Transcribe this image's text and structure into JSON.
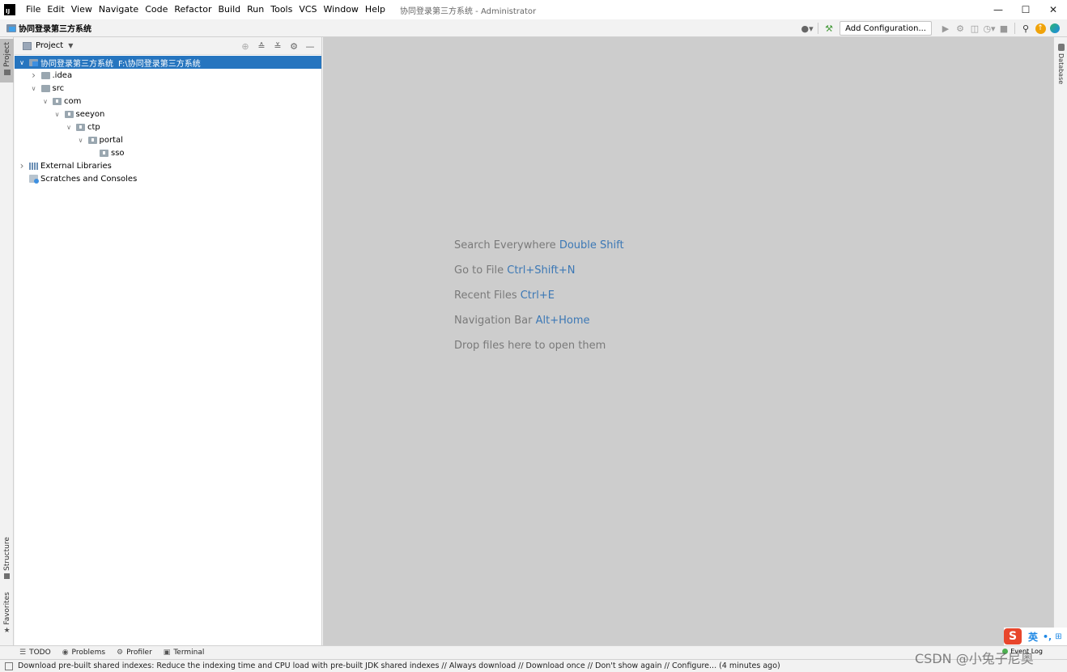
{
  "titlebar": {
    "logo": "IJ",
    "menu": [
      "File",
      "Edit",
      "View",
      "Navigate",
      "Code",
      "Refactor",
      "Build",
      "Run",
      "Tools",
      "VCS",
      "Window",
      "Help"
    ],
    "window_title": "协同登录第三方系统 - Administrator",
    "buttons": {
      "minimize": "—",
      "maximize": "☐",
      "close": "✕"
    }
  },
  "navbar": {
    "project_name": "协同登录第三方系统",
    "add_configuration": "Add Configuration...",
    "icons": [
      "user-icon",
      "hammer-icon",
      "run-icon",
      "debug-icon",
      "coverage-icon",
      "profile-icon",
      "stop-icon",
      "search-icon",
      "update-icon",
      "jetbrains-icon"
    ]
  },
  "left_stripe": {
    "project": "Project",
    "structure": "Structure",
    "favorites": "Favorites"
  },
  "project_panel": {
    "title": "Project",
    "tree": [
      {
        "label": "协同登录第三方系统",
        "path": "F:\\协同登录第三方系统",
        "depth": 0,
        "expanded": true,
        "type": "project",
        "selected": true
      },
      {
        "label": ".idea",
        "depth": 1,
        "expanded": false,
        "type": "folder"
      },
      {
        "label": "src",
        "depth": 1,
        "expanded": true,
        "type": "folder"
      },
      {
        "label": "com",
        "depth": 2,
        "expanded": true,
        "type": "package"
      },
      {
        "label": "seeyon",
        "depth": 3,
        "expanded": true,
        "type": "package"
      },
      {
        "label": "ctp",
        "depth": 4,
        "expanded": true,
        "type": "package"
      },
      {
        "label": "portal",
        "depth": 5,
        "expanded": true,
        "type": "package"
      },
      {
        "label": "sso",
        "depth": 6,
        "expanded": null,
        "type": "package"
      },
      {
        "label": "External Libraries",
        "depth": 0,
        "expanded": false,
        "type": "library"
      },
      {
        "label": "Scratches and Consoles",
        "depth": 0,
        "expanded": null,
        "type": "scratch"
      }
    ]
  },
  "editor": {
    "hints": [
      {
        "text": "Search Everywhere",
        "key": "Double Shift"
      },
      {
        "text": "Go to File",
        "key": "Ctrl+Shift+N"
      },
      {
        "text": "Recent Files",
        "key": "Ctrl+E"
      },
      {
        "text": "Navigation Bar",
        "key": "Alt+Home"
      },
      {
        "text": "Drop files here to open them",
        "key": ""
      }
    ]
  },
  "right_stripe": {
    "database": "Database"
  },
  "bottom_tools": [
    {
      "label": "TODO",
      "icon": "todo-icon"
    },
    {
      "label": "Problems",
      "icon": "problems-icon"
    },
    {
      "label": "Profiler",
      "icon": "profiler-icon"
    },
    {
      "label": "Terminal",
      "icon": "terminal-icon"
    }
  ],
  "event_log": "Event Log",
  "status_text": "Download pre-built shared indexes: Reduce the indexing time and CPU load with pre-built JDK shared indexes // Always download // Download once // Don't show again // Configure... (4 minutes ago)",
  "ime": {
    "logo": "S",
    "lang": "英",
    "punct": "•,",
    "extra": "⊞"
  },
  "watermark": "CSDN @小兔子尼奥"
}
